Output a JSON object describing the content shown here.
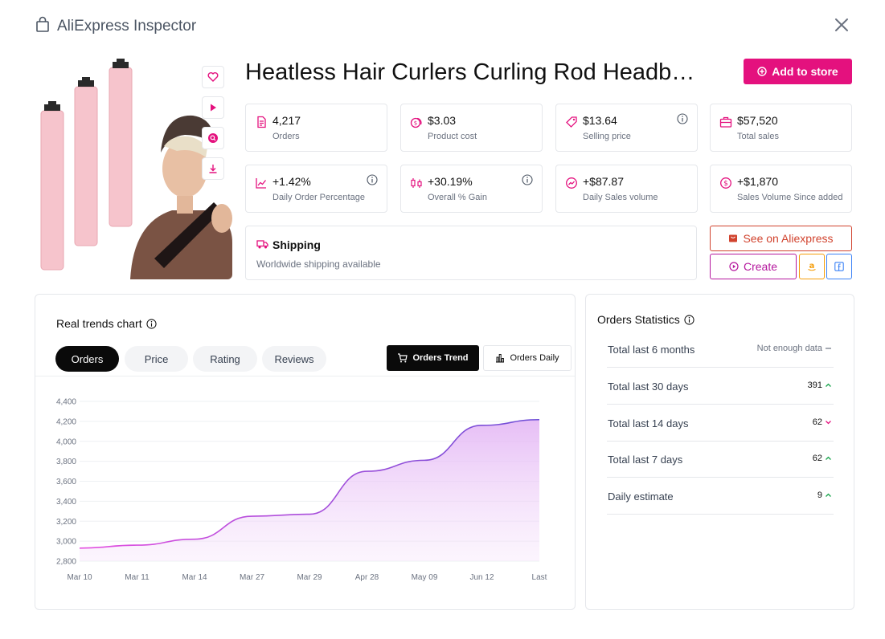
{
  "app": {
    "title": "AliExpress Inspector"
  },
  "product": {
    "title": "Heatless Hair Curlers Curling Rod Headb…",
    "add_to_store_label": "Add to store"
  },
  "stats": [
    {
      "value": "4,217",
      "label": "Orders",
      "icon": "document-icon",
      "info": false
    },
    {
      "value": "$3.03",
      "label": "Product cost",
      "icon": "coins-icon",
      "info": false
    },
    {
      "value": "$13.64",
      "label": "Selling price",
      "icon": "tag-icon",
      "info": true
    },
    {
      "value": "$57,520",
      "label": "Total sales",
      "icon": "briefcase-icon",
      "info": false
    },
    {
      "value": "+1.42%",
      "label": "Daily Order Percentage",
      "icon": "line-chart-icon",
      "info": true
    },
    {
      "value": "+30.19%",
      "label": "Overall % Gain",
      "icon": "candles-icon",
      "info": true
    },
    {
      "value": "+$87.87",
      "label": "Daily Sales volume",
      "icon": "trend-circle-icon",
      "info": false
    },
    {
      "value": "+$1,870",
      "label": "Sales Volume Since added",
      "icon": "dollar-circle-icon",
      "info": false
    }
  ],
  "shipping": {
    "title": "Shipping",
    "description": "Worldwide shipping available"
  },
  "actions": {
    "see_aliexpress": "See on Aliexpress",
    "create": "Create"
  },
  "chart_panel": {
    "title": "Real trends chart",
    "tabs": [
      "Orders",
      "Price",
      "Rating",
      "Reviews"
    ],
    "active_tab": "Orders",
    "trend_buttons": [
      "Orders Trend",
      "Orders Daily"
    ],
    "active_trend": "Orders Trend"
  },
  "chart_data": {
    "type": "area",
    "x": [
      "Mar 10",
      "Mar 11",
      "Mar 14",
      "Mar 27",
      "Mar 29",
      "Apr 28",
      "May 09",
      "Jun 12",
      "Last"
    ],
    "y_ticks": [
      "4,400",
      "4,200",
      "4,000",
      "3,800",
      "3,600",
      "3,400",
      "3,200",
      "3,000",
      "2,800"
    ],
    "ylim": [
      2800,
      4400
    ],
    "series": [
      {
        "values": [
          2930,
          2960,
          3020,
          3250,
          3270,
          3700,
          3810,
          4160,
          4217
        ]
      }
    ],
    "grid": true,
    "colors": {
      "line_start": "#e44fe0",
      "line_end": "#6d4ed6",
      "fill": "#e6b8f5"
    }
  },
  "orders_statistics": {
    "title": "Orders Statistics",
    "rows": [
      {
        "label": "Total last 6 months",
        "value": "Not enough data",
        "trend": "none"
      },
      {
        "label": "Total last 30 days",
        "value": "391",
        "trend": "up"
      },
      {
        "label": "Total last 14 days",
        "value": "62",
        "trend": "down"
      },
      {
        "label": "Total last 7 days",
        "value": "62",
        "trend": "up"
      },
      {
        "label": "Daily estimate",
        "value": "9",
        "trend": "up"
      }
    ]
  },
  "colors": {
    "accent": "#e4117e",
    "aliexpress": "#d1432e",
    "create": "#b5179e",
    "up": "#16a34a",
    "down": "#e4117e"
  }
}
